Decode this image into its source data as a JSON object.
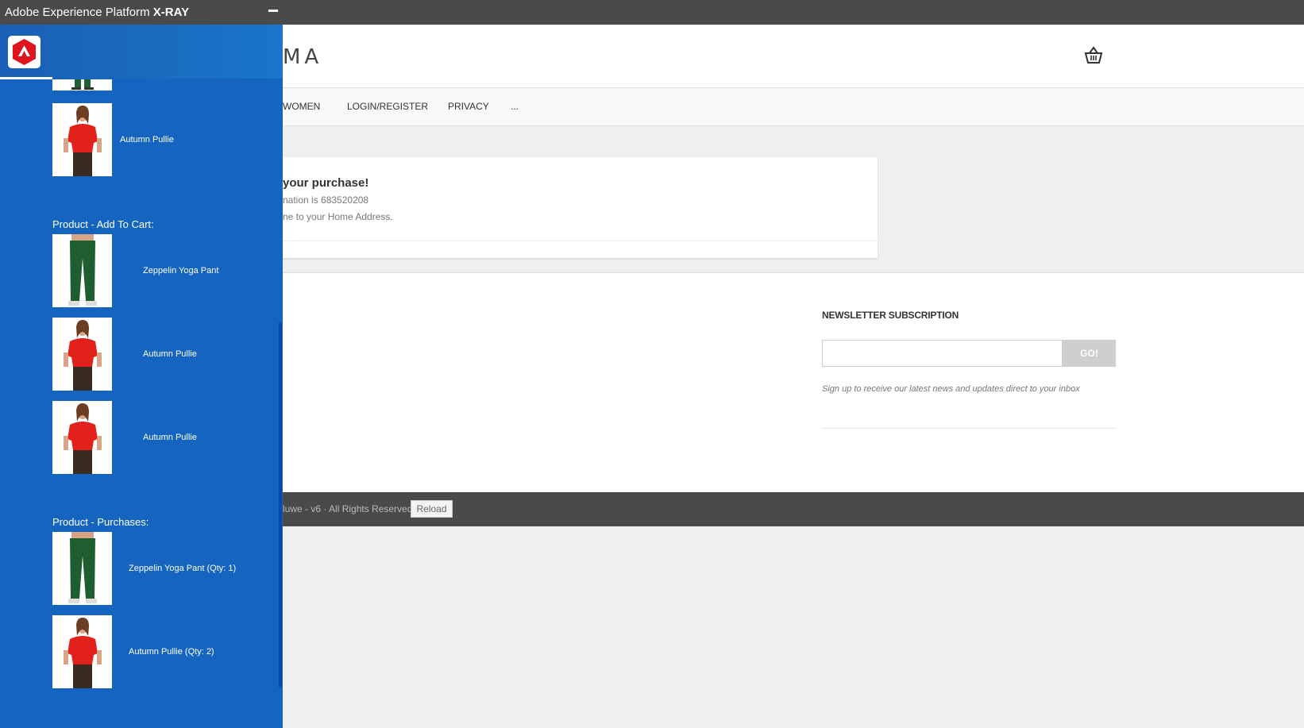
{
  "xray": {
    "title_prefix": "Adobe Experience Platform",
    "title_bold": "X-RAY",
    "sections": {
      "add_to_cart_title": "Product - Add To Cart:",
      "purchases_title": "Product - Purchases:"
    },
    "products": {
      "top_item": "Autumn Pullie",
      "cart_1": "Zeppelin Yoga Pant",
      "cart_2": "Autumn Pullie",
      "cart_3": "Autumn Pullie",
      "purchase_1": "Zeppelin Yoga Pant (Qty: 1)",
      "purchase_2": "Autumn Pullie (Qty: 2)"
    }
  },
  "site": {
    "logo": "MA",
    "nav": [
      "WOMEN",
      "LOGIN/REGISTER",
      "PRIVACY",
      "..."
    ],
    "confirmation": {
      "title": "your purchase!",
      "line1": "nation is 683520208",
      "line2": "ne to your Home Address."
    },
    "newsletter": {
      "title": "NEWSLETTER SUBSCRIPTION",
      "button": "GO!",
      "note": "Sign up to receive our latest news and updates direct to your inbox"
    },
    "footer": {
      "copyright": "luwe - v6 · All Rights Reserved.",
      "reload": "Reload"
    }
  },
  "colors": {
    "panel_blue": "#1565c0",
    "top_bar": "#4a4a4a",
    "shirt_red": "#e3211c",
    "pant_green": "#1f5e2e"
  }
}
